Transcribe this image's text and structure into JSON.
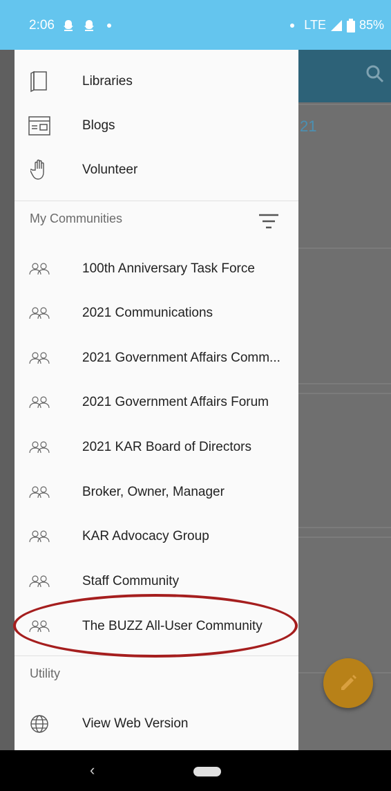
{
  "status_bar": {
    "time": "2:06",
    "network": "LTE",
    "battery": "85%"
  },
  "background_app": {
    "partial_text": "21"
  },
  "menu": [
    {
      "label": "Libraries",
      "icon": "book-icon"
    },
    {
      "label": "Blogs",
      "icon": "browser-icon"
    },
    {
      "label": "Volunteer",
      "icon": "hand-icon"
    }
  ],
  "communities_header": "My Communities",
  "communities": [
    "100th Anniversary Task Force",
    "2021 Communications",
    "2021 Government Affairs Comm...",
    "2021 Government Affairs Forum",
    "2021 KAR Board of Directors",
    "Broker, Owner, Manager",
    "KAR Advocacy Group",
    "Staff Community",
    "The BUZZ All-User Community"
  ],
  "utility_header": "Utility",
  "utility": [
    {
      "label": "View Web Version",
      "icon": "globe-icon"
    }
  ],
  "colors": {
    "status_bar": "#64c5ee",
    "toolbar": "#2d6278",
    "fab": "#b88118",
    "highlight": "#a51e1e"
  }
}
